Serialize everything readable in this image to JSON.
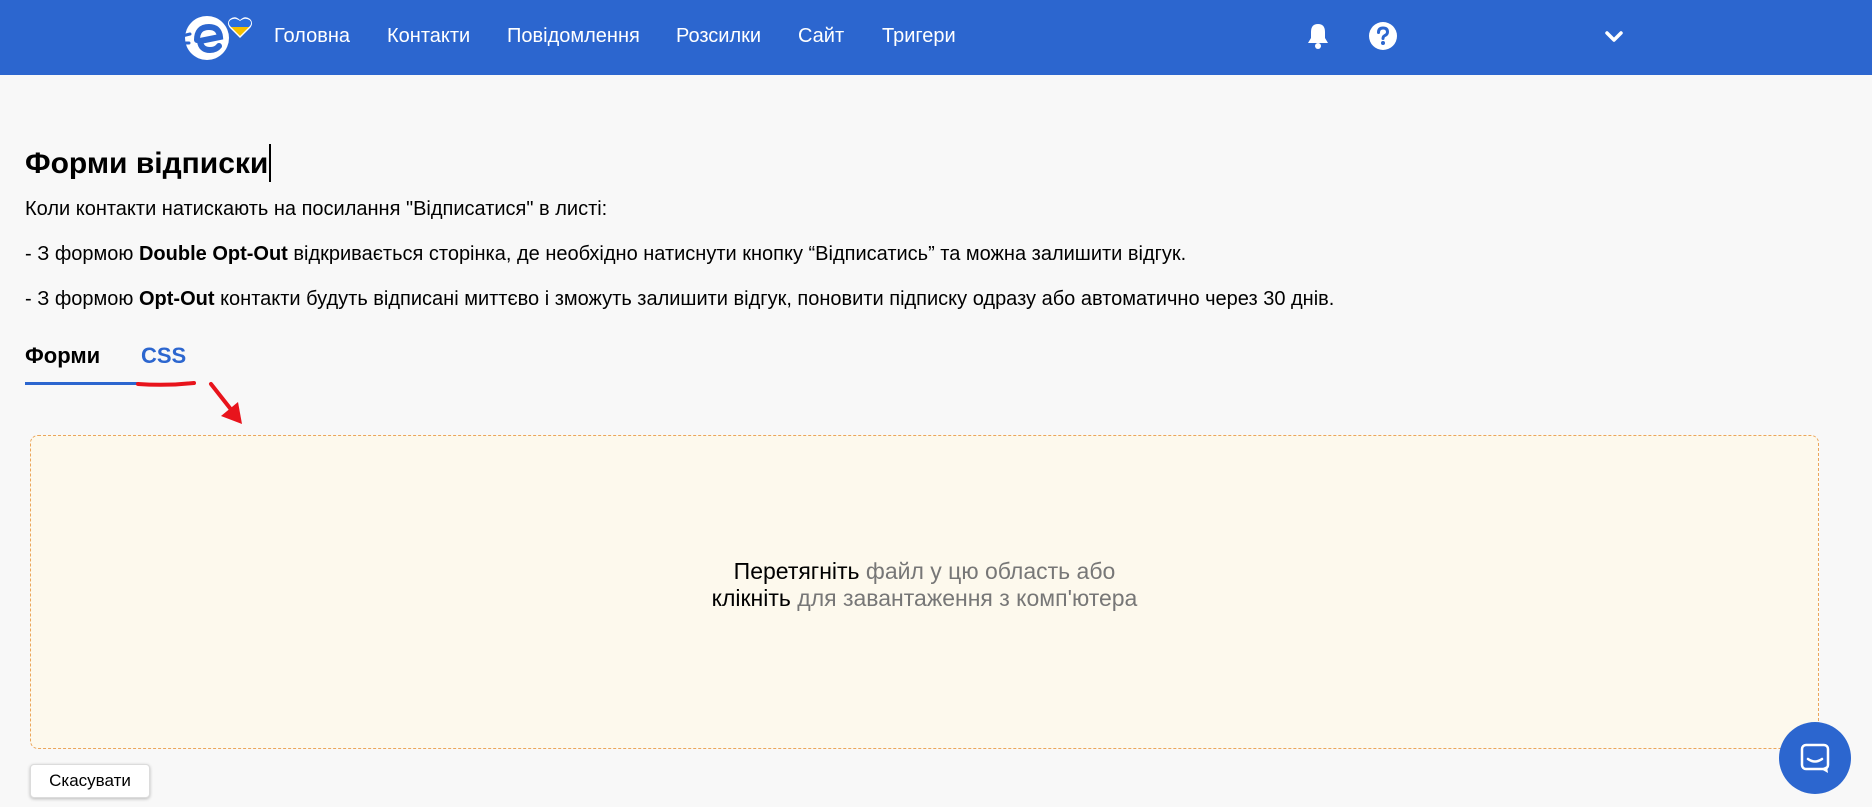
{
  "header": {
    "brand_colors": {
      "bar": "#2c66cf",
      "flag_blue": "#2a6ee0",
      "flag_yellow": "#f6c000"
    },
    "logo_icon": "esputnik-logo-with-heart",
    "nav": [
      {
        "label": "Головна"
      },
      {
        "label": "Контакти"
      },
      {
        "label": "Повідомлення"
      },
      {
        "label": "Розсилки"
      },
      {
        "label": "Сайт"
      },
      {
        "label": "Тригери"
      }
    ],
    "icons": [
      "bell-icon",
      "help-icon",
      "chevron-down-icon"
    ]
  },
  "page": {
    "title": "Форми відписки",
    "intro": "Коли контакти натискають на посилання \"Відписатися\" в листі:",
    "line_double": {
      "prefix": "- З формою ",
      "bold": "Double Opt-Out",
      "suffix": " відкривається сторінка, де необхідно натиснути кнопку “Відписатись” та можна залишити відгук."
    },
    "line_opt": {
      "prefix": "- З формою ",
      "bold": "Opt-Out",
      "suffix": " контакти будуть відписані миттєво і зможуть залишити відгук, поновити підписку одразу або автоматично через 30 днів."
    }
  },
  "tabs": {
    "forms": "Форми",
    "css": "CSS",
    "active": "Форми"
  },
  "dropzone": {
    "drag_strong": "Перетягніть",
    "drag_rest": " файл у цю область або",
    "click_strong": "клікніть",
    "click_rest": " для завантаження з комп'ютера"
  },
  "actions": {
    "cancel": "Скасувати"
  },
  "chat": {
    "icon": "chat-icon"
  },
  "annotation_color": "#e8141c"
}
